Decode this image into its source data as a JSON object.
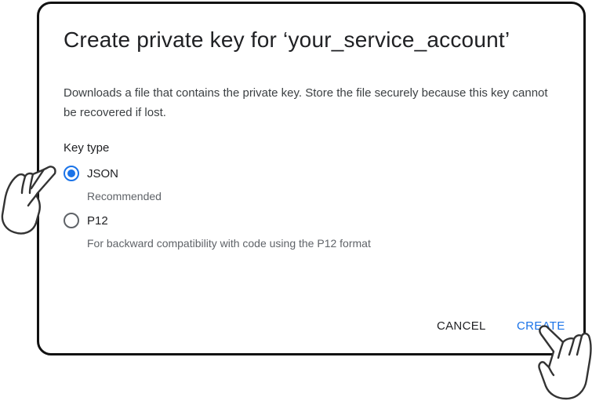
{
  "dialog": {
    "title": "Create private key for ‘your_service_account’",
    "description": "Downloads a file that contains the private key. Store the file securely because this key cannot be recovered if lost.",
    "key_type_label": "Key type",
    "options": [
      {
        "label": "JSON",
        "sublabel": "Recommended",
        "selected": true
      },
      {
        "label": "P12",
        "sublabel": "For backward compatibility with code using the P12 format",
        "selected": false
      }
    ],
    "actions": {
      "cancel_label": "CANCEL",
      "create_label": "CREATE"
    }
  },
  "colors": {
    "accent": "#1a73e8",
    "text_primary": "#202124",
    "text_secondary": "#5f6368",
    "border": "#111111"
  },
  "icons": {
    "pointer": "hand-pointer-icon"
  }
}
